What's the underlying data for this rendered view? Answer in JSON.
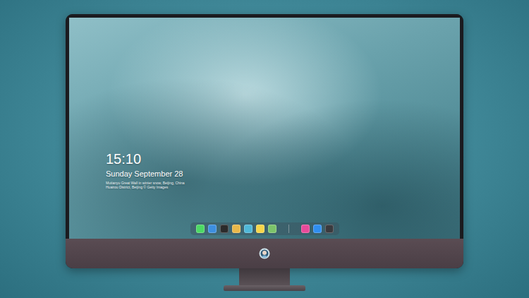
{
  "lock_screen": {
    "time": "15:10",
    "date": "Sunday September 28",
    "caption_lines": [
      "Mutianyu Great Wall in winter snow, Beijing, China",
      "Huairou District, Beijing © Getty Images"
    ]
  },
  "dock": {
    "items": [
      {
        "kind": "app",
        "color": "#4cd964"
      },
      {
        "kind": "app",
        "color": "#3d8fe0"
      },
      {
        "kind": "app",
        "color": "#2b2b2b"
      },
      {
        "kind": "app",
        "color": "#e8b84a"
      },
      {
        "kind": "app",
        "color": "#4fb8d8"
      },
      {
        "kind": "app",
        "color": "#f7d54a"
      },
      {
        "kind": "app",
        "color": "#7cc36a"
      },
      {
        "kind": "divider",
        "color": "#bfc8cc"
      },
      {
        "kind": "app",
        "color": "#e84a9a"
      },
      {
        "kind": "app",
        "color": "#2f8ef0"
      },
      {
        "kind": "app",
        "color": "#3a3a3e"
      }
    ]
  }
}
